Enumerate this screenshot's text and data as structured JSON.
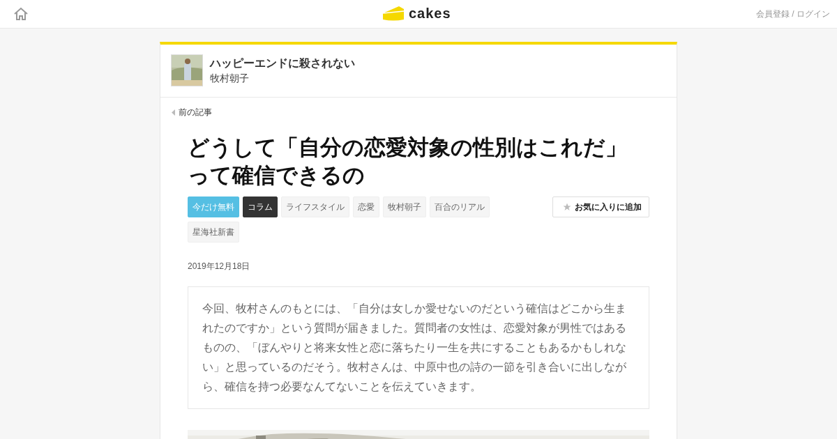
{
  "header": {
    "logo": "cakes",
    "account_link": "会員登録 / ログイン"
  },
  "series": {
    "title": "ハッピーエンドに殺されない",
    "author": "牧村朝子"
  },
  "prev_link": "前の記事",
  "article": {
    "title": "どうして「自分の恋愛対象の性別はこれだ」って確信できるの",
    "tags": [
      {
        "label": "今だけ無料",
        "kind": "free"
      },
      {
        "label": "コラム",
        "kind": "category"
      },
      {
        "label": "ライフスタイル",
        "kind": "tag"
      },
      {
        "label": "恋愛",
        "kind": "tag"
      },
      {
        "label": "牧村朝子",
        "kind": "tag"
      },
      {
        "label": "百合のリアル",
        "kind": "tag"
      },
      {
        "label": "星海社新書",
        "kind": "tag"
      }
    ],
    "favorite_button": "お気に入りに追加",
    "date": "2019年12月18日",
    "lead": "今回、牧村さんのもとには、「自分は女しか愛せないのだという確信はどこから生まれたのですか」という質問が届きました。質問者の女性は、恋愛対象が男性ではあるものの、「ぼんやりと将来女性と恋に落ちたり一生を共にすることもあるかもしれない」と思っているのだそう。牧村さんは、中原中也の詩の一節を引き合いに出しながら、確信を持つ必要なんてないことを伝えていきます。"
  }
}
